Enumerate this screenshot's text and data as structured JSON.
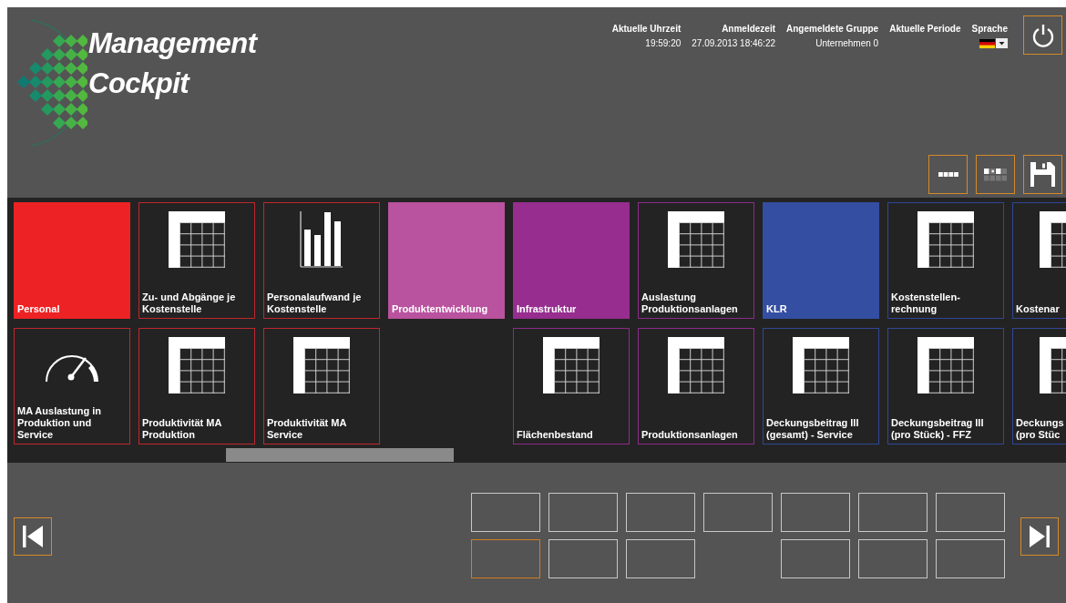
{
  "logo": {
    "lines": [
      "Management",
      "Cockpit"
    ]
  },
  "header": {
    "info": [
      {
        "label": "Aktuelle Uhrzeit",
        "value": "19:59:20"
      },
      {
        "label": "Anmeldezeit",
        "value": "27.09.2013 18:46:22"
      },
      {
        "label": "Angemeldete Gruppe",
        "value": "Unternehmen 0"
      },
      {
        "label": "Aktuelle Periode"
      }
    ],
    "language": {
      "label": "Sprache"
    }
  },
  "tile_rows": [
    [
      {
        "kind": "category",
        "label": "Personal",
        "color": "#ed2224"
      },
      {
        "kind": "table",
        "label": "Zu- und Abgänge je Kostenstelle",
        "color": "#c0272d"
      },
      {
        "kind": "chart",
        "label": "Personalaufwand je Kostenstelle",
        "color": "#c0272d"
      },
      {
        "kind": "category",
        "label": "Produktentwicklung",
        "color": "#b9529f"
      },
      {
        "kind": "category",
        "label": "Infrastruktur",
        "color": "#962d8f"
      },
      {
        "kind": "table",
        "label": "Auslastung Produktionsanlagen",
        "color": "#8e2a8a"
      },
      {
        "kind": "category",
        "label": "KLR",
        "color": "#344ea1"
      },
      {
        "kind": "table",
        "label": "Kostenstellen-rechnung",
        "color": "#2f4796"
      },
      {
        "kind": "table",
        "label": "Kostenar",
        "color": "#2f4796"
      }
    ],
    [
      {
        "kind": "gauge",
        "label": "MA Auslastung in Produktion und Service",
        "color": "#c0272d"
      },
      {
        "kind": "table",
        "label": "Produktivität MA Produktion",
        "color": "#c0272d"
      },
      {
        "kind": "table",
        "label": "Produktivität MA Service",
        "color": "#c0272d"
      },
      {
        "kind": "empty"
      },
      {
        "kind": "table",
        "label": "Flächenbestand",
        "color": "#8e2a8a"
      },
      {
        "kind": "table",
        "label": "Produktionsanlagen",
        "color": "#8e2a8a"
      },
      {
        "kind": "table",
        "label": "Deckungsbeitrag III (gesamt) - Service",
        "color": "#2f4796"
      },
      {
        "kind": "table",
        "label": "Deckungsbeitrag III (pro Stück) - FFZ",
        "color": "#2f4796"
      },
      {
        "kind": "table",
        "label": "Deckungs (pro Stüc",
        "color": "#2f4796"
      }
    ]
  ],
  "pager": [
    [
      {
        "kind": "page",
        "selected": false
      },
      {
        "kind": "page",
        "selected": false
      },
      {
        "kind": "page",
        "selected": false
      },
      {
        "kind": "page",
        "selected": false
      },
      {
        "kind": "page",
        "selected": false
      },
      {
        "kind": "page",
        "selected": false
      },
      {
        "kind": "page",
        "selected": false
      }
    ],
    [
      {
        "kind": "page",
        "selected": true
      },
      {
        "kind": "page",
        "selected": false
      },
      {
        "kind": "page",
        "selected": false
      },
      {
        "kind": "gap"
      },
      {
        "kind": "page",
        "selected": false
      },
      {
        "kind": "page",
        "selected": false
      },
      {
        "kind": "page",
        "selected": false
      }
    ]
  ]
}
